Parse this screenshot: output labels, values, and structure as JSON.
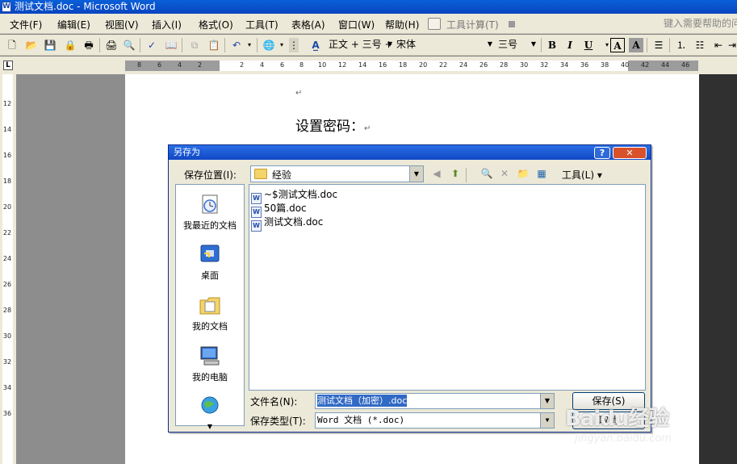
{
  "window": {
    "title": "测试文档.doc - Microsoft Word"
  },
  "menu": {
    "items": [
      "文件(F)",
      "编辑(E)",
      "视图(V)",
      "插入(I)",
      "格式(O)",
      "工具(T)",
      "表格(A)",
      "窗口(W)",
      "帮助(H)",
      "工具计算(T)"
    ],
    "help_placeholder": "键入需要帮助的问题"
  },
  "toolbar": {
    "style_label": "正文 + 三号 +",
    "font_name": "宋体",
    "font_size": "三号",
    "bold": "B",
    "italic": "I",
    "underline": "U",
    "char_border": "A",
    "char_shading": "A"
  },
  "ruler": {
    "corner": "L",
    "h_ticks": [
      "8",
      "6",
      "4",
      "2",
      "2",
      "4",
      "6",
      "8",
      "10",
      "12",
      "14",
      "16",
      "18",
      "20",
      "22",
      "24",
      "26",
      "28",
      "30",
      "32",
      "34",
      "36",
      "38",
      "40",
      "42",
      "44",
      "46"
    ],
    "v_ticks": [
      "12",
      "14",
      "16",
      "18",
      "20",
      "22",
      "24",
      "26",
      "28",
      "30",
      "32",
      "34",
      "36"
    ]
  },
  "document": {
    "heading": "设置密码：",
    "para_mark": "↵"
  },
  "dialog": {
    "title": "另存为",
    "save_in_label": "保存位置(I):",
    "save_in_value": "经验",
    "tools_label": "工具(L)",
    "places": [
      {
        "label": "我最近的文档"
      },
      {
        "label": "桌面"
      },
      {
        "label": "我的文档"
      },
      {
        "label": "我的电脑"
      }
    ],
    "files": [
      "~$测试文档.doc",
      "50篇.doc",
      "测试文档.doc"
    ],
    "filename_label": "文件名(N):",
    "filename_value": "测试文档（加密）.doc",
    "filetype_label": "保存类型(T):",
    "filetype_value": "Word 文档 (*.doc)",
    "save_button": "保存(S)",
    "cancel_button": "取消"
  },
  "watermark": {
    "brand": "Baidu经验",
    "url": "jingyan.baidu.com"
  }
}
